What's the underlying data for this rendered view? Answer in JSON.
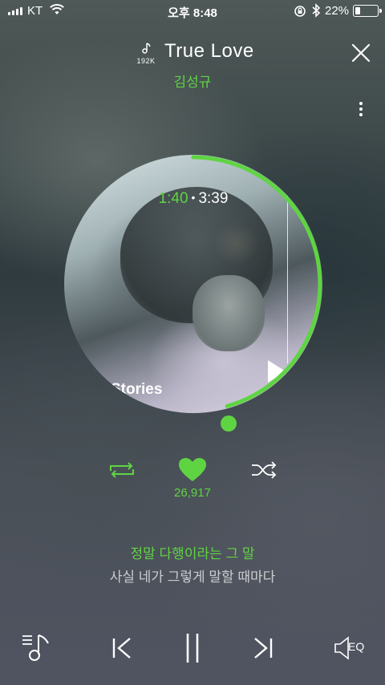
{
  "status_bar": {
    "carrier": "KT",
    "time": "오후 8:48",
    "battery_percent": "22%",
    "battery_level": 0.22
  },
  "header": {
    "quality_label": "192K",
    "song_title": "True Love",
    "artist": "김성규"
  },
  "player": {
    "elapsed": "1:40",
    "total": "3:39",
    "progress": 0.457,
    "album_text": "Stories",
    "like_count": "26,917",
    "liked": true
  },
  "lyrics": {
    "current": "정말 다행이라는 그 말",
    "next": "사실 네가 그렇게 말할 때마다"
  },
  "bottom": {
    "eq_label": "EQ"
  },
  "colors": {
    "accent": "#5fd443",
    "text": "#ffffff"
  }
}
